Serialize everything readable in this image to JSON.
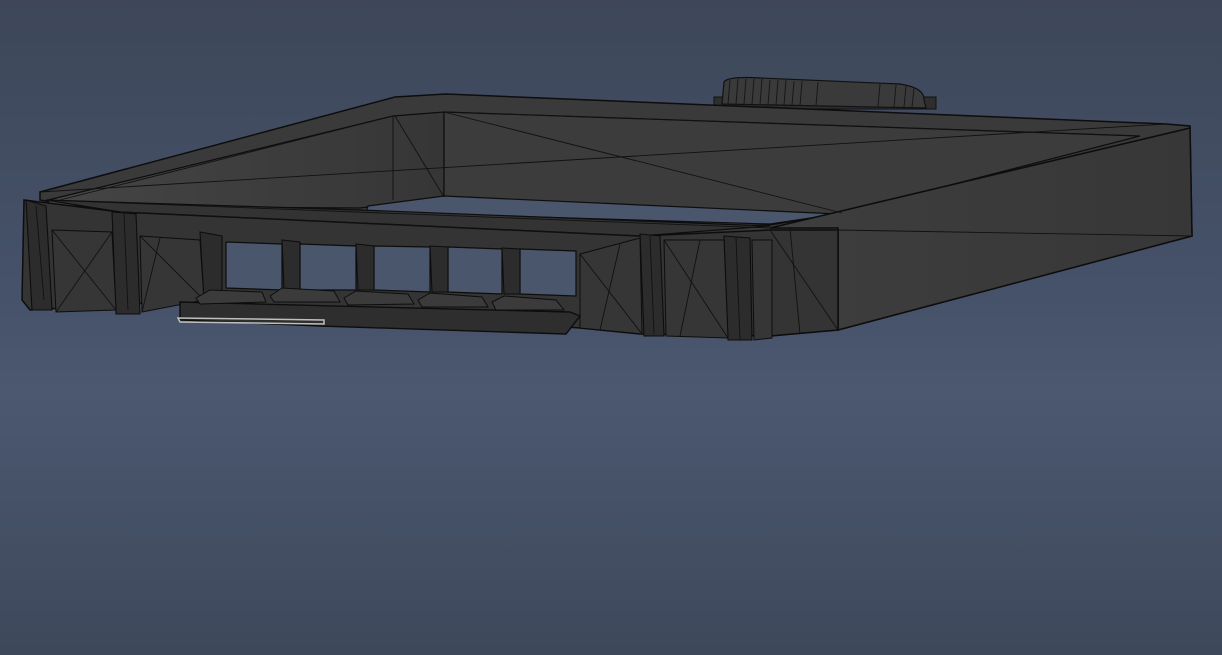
{
  "viewport": {
    "background_top": "#3d4759",
    "background_bottom": "#3e485b",
    "mode": "wireframe-shaded"
  },
  "model": {
    "object": "tray",
    "face_color": "#3a3a3a",
    "face_dark_color": "#2b2b2b",
    "edge_color": "#0d0d0d",
    "highlight_color": "#bfbfbf"
  }
}
